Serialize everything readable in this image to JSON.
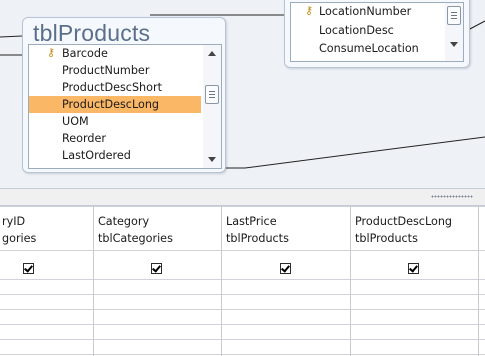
{
  "diagram": {
    "products_table": {
      "title": "tblProducts",
      "fields": [
        {
          "name": "Barcode",
          "key": true,
          "selected": false
        },
        {
          "name": "ProductNumber",
          "key": false,
          "selected": false
        },
        {
          "name": "ProductDescShort",
          "key": false,
          "selected": false
        },
        {
          "name": "ProductDescLong",
          "key": false,
          "selected": true
        },
        {
          "name": "UOM",
          "key": false,
          "selected": false
        },
        {
          "name": "Reorder",
          "key": false,
          "selected": false
        },
        {
          "name": "LastOrdered",
          "key": false,
          "selected": false
        }
      ]
    },
    "location_table": {
      "fields": [
        {
          "name": "LocationNumber",
          "key": true
        },
        {
          "name": "LocationDesc",
          "key": false
        },
        {
          "name": "ConsumeLocation",
          "key": false
        }
      ]
    },
    "key_icon_name": "primary-key-icon",
    "selection_color": "#fab766"
  },
  "grid": {
    "columns": [
      {
        "field": "ryID",
        "table": "gories",
        "show": true
      },
      {
        "field": "Category",
        "table": "tblCategories",
        "show": true
      },
      {
        "field": "LastPrice",
        "table": "tblProducts",
        "show": true
      },
      {
        "field": "ProductDescLong",
        "table": "tblProducts",
        "show": true
      }
    ]
  }
}
